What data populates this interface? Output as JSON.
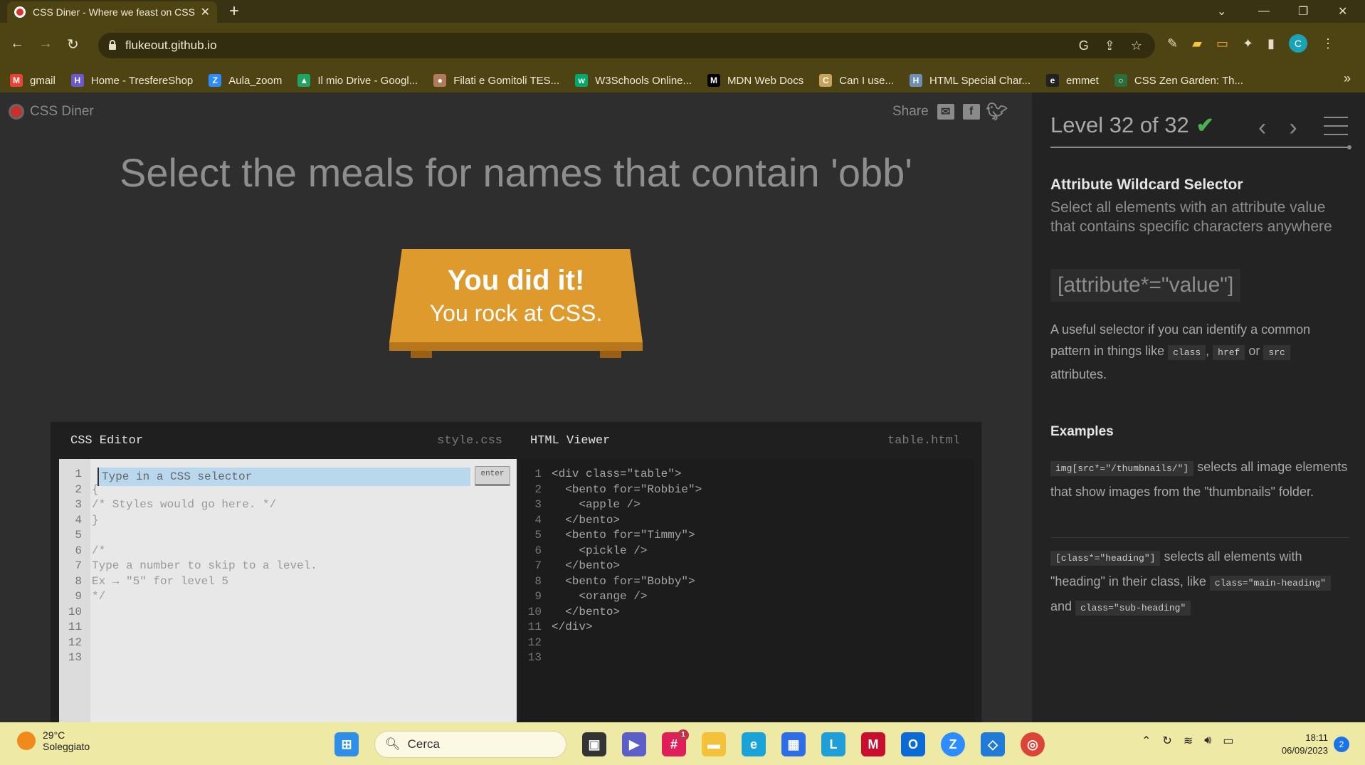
{
  "browser": {
    "tab_title": "CSS Diner - Where we feast on CSS",
    "url": "flukeout.github.io",
    "new_tab": "+",
    "bookmarks": [
      {
        "label": "gmail",
        "color": "#ea4335",
        "glyph": "M"
      },
      {
        "label": "Home - TresfereShop",
        "color": "#6a5acd",
        "glyph": "H"
      },
      {
        "label": "Aula_zoom",
        "color": "#2d8cff",
        "glyph": "Z"
      },
      {
        "label": "Il mio Drive - Googl...",
        "color": "#1fa463",
        "glyph": "▲"
      },
      {
        "label": "Filati e Gomitoli TES...",
        "color": "#b07b5a",
        "glyph": "●"
      },
      {
        "label": "W3Schools Online...",
        "color": "#04aa6d",
        "glyph": "w"
      },
      {
        "label": "MDN Web Docs",
        "color": "#000000",
        "glyph": "M"
      },
      {
        "label": "Can I use...",
        "color": "#c8a35a",
        "glyph": "C"
      },
      {
        "label": "HTML Special Char...",
        "color": "#6d8fb5",
        "glyph": "H"
      },
      {
        "label": "emmet",
        "color": "#222222",
        "glyph": "e"
      },
      {
        "label": "CSS Zen Garden: Th...",
        "color": "#2b6e3b",
        "glyph": "○"
      }
    ],
    "more": "»"
  },
  "game": {
    "logo": "CSS Diner",
    "share_label": "Share",
    "instruction": "Select the meals for names that contain 'obb'",
    "win_title": "You did it!",
    "win_subtitle": "You rock at CSS."
  },
  "editor": {
    "css_title": "CSS Editor",
    "css_file": "style.css",
    "html_title": "HTML Viewer",
    "html_file": "table.html",
    "input_placeholder": "Type in a CSS selector",
    "enter_label": "enter",
    "line_numbers": [
      "1",
      "2",
      "3",
      "4",
      "5",
      "6",
      "7",
      "8",
      "9",
      "10",
      "11",
      "12",
      "13"
    ],
    "css_lines": [
      "",
      "{",
      "/* Styles would go here. */",
      "}",
      "",
      "/*",
      "Type a number to skip to a level.",
      "Ex → \"5\" for level 5",
      "*/",
      "",
      "",
      "",
      ""
    ],
    "html_lines": [
      "<div class=\"table\">",
      "  <bento for=\"Robbie\">",
      "    <apple />",
      "  </bento>",
      "  <bento for=\"Timmy\">",
      "    <pickle />",
      "  </bento>",
      "  <bento for=\"Bobby\">",
      "    <orange />",
      "  </bento>",
      "</div>",
      "",
      ""
    ]
  },
  "sidebar": {
    "level": "Level 32 of 32",
    "selector_name": "Attribute Wildcard Selector",
    "selector_title": "Select all elements with an attribute value that contains specific characters anywhere",
    "syntax": "[attribute*=\"value\"]",
    "hint_before": "A useful selector if you can identify a common pattern in things like",
    "hint_code1": "class",
    "hint_sep": ",",
    "hint_code2": "href",
    "hint_or": "or",
    "hint_code3": "src",
    "hint_after": "attributes.",
    "examples_title": "Examples",
    "ex1_code": "img[src*=\"/thumbnails/\"]",
    "ex1_text": "selects all image elements that show images from the \"thumbnails\" folder.",
    "ex2_code": "[class*=\"heading\"]",
    "ex2_text_a": "selects all elements with \"heading\" in their class, like",
    "ex2_code2": "class=\"main-heading\"",
    "ex2_and": "and",
    "ex2_code3": "class=\"sub-heading\""
  },
  "taskbar": {
    "temp": "29°C",
    "weather": "Soleggiato",
    "search": "Cerca",
    "time": "18:11",
    "date": "06/09/2023",
    "notifications": "2",
    "slack_badge": "1"
  }
}
